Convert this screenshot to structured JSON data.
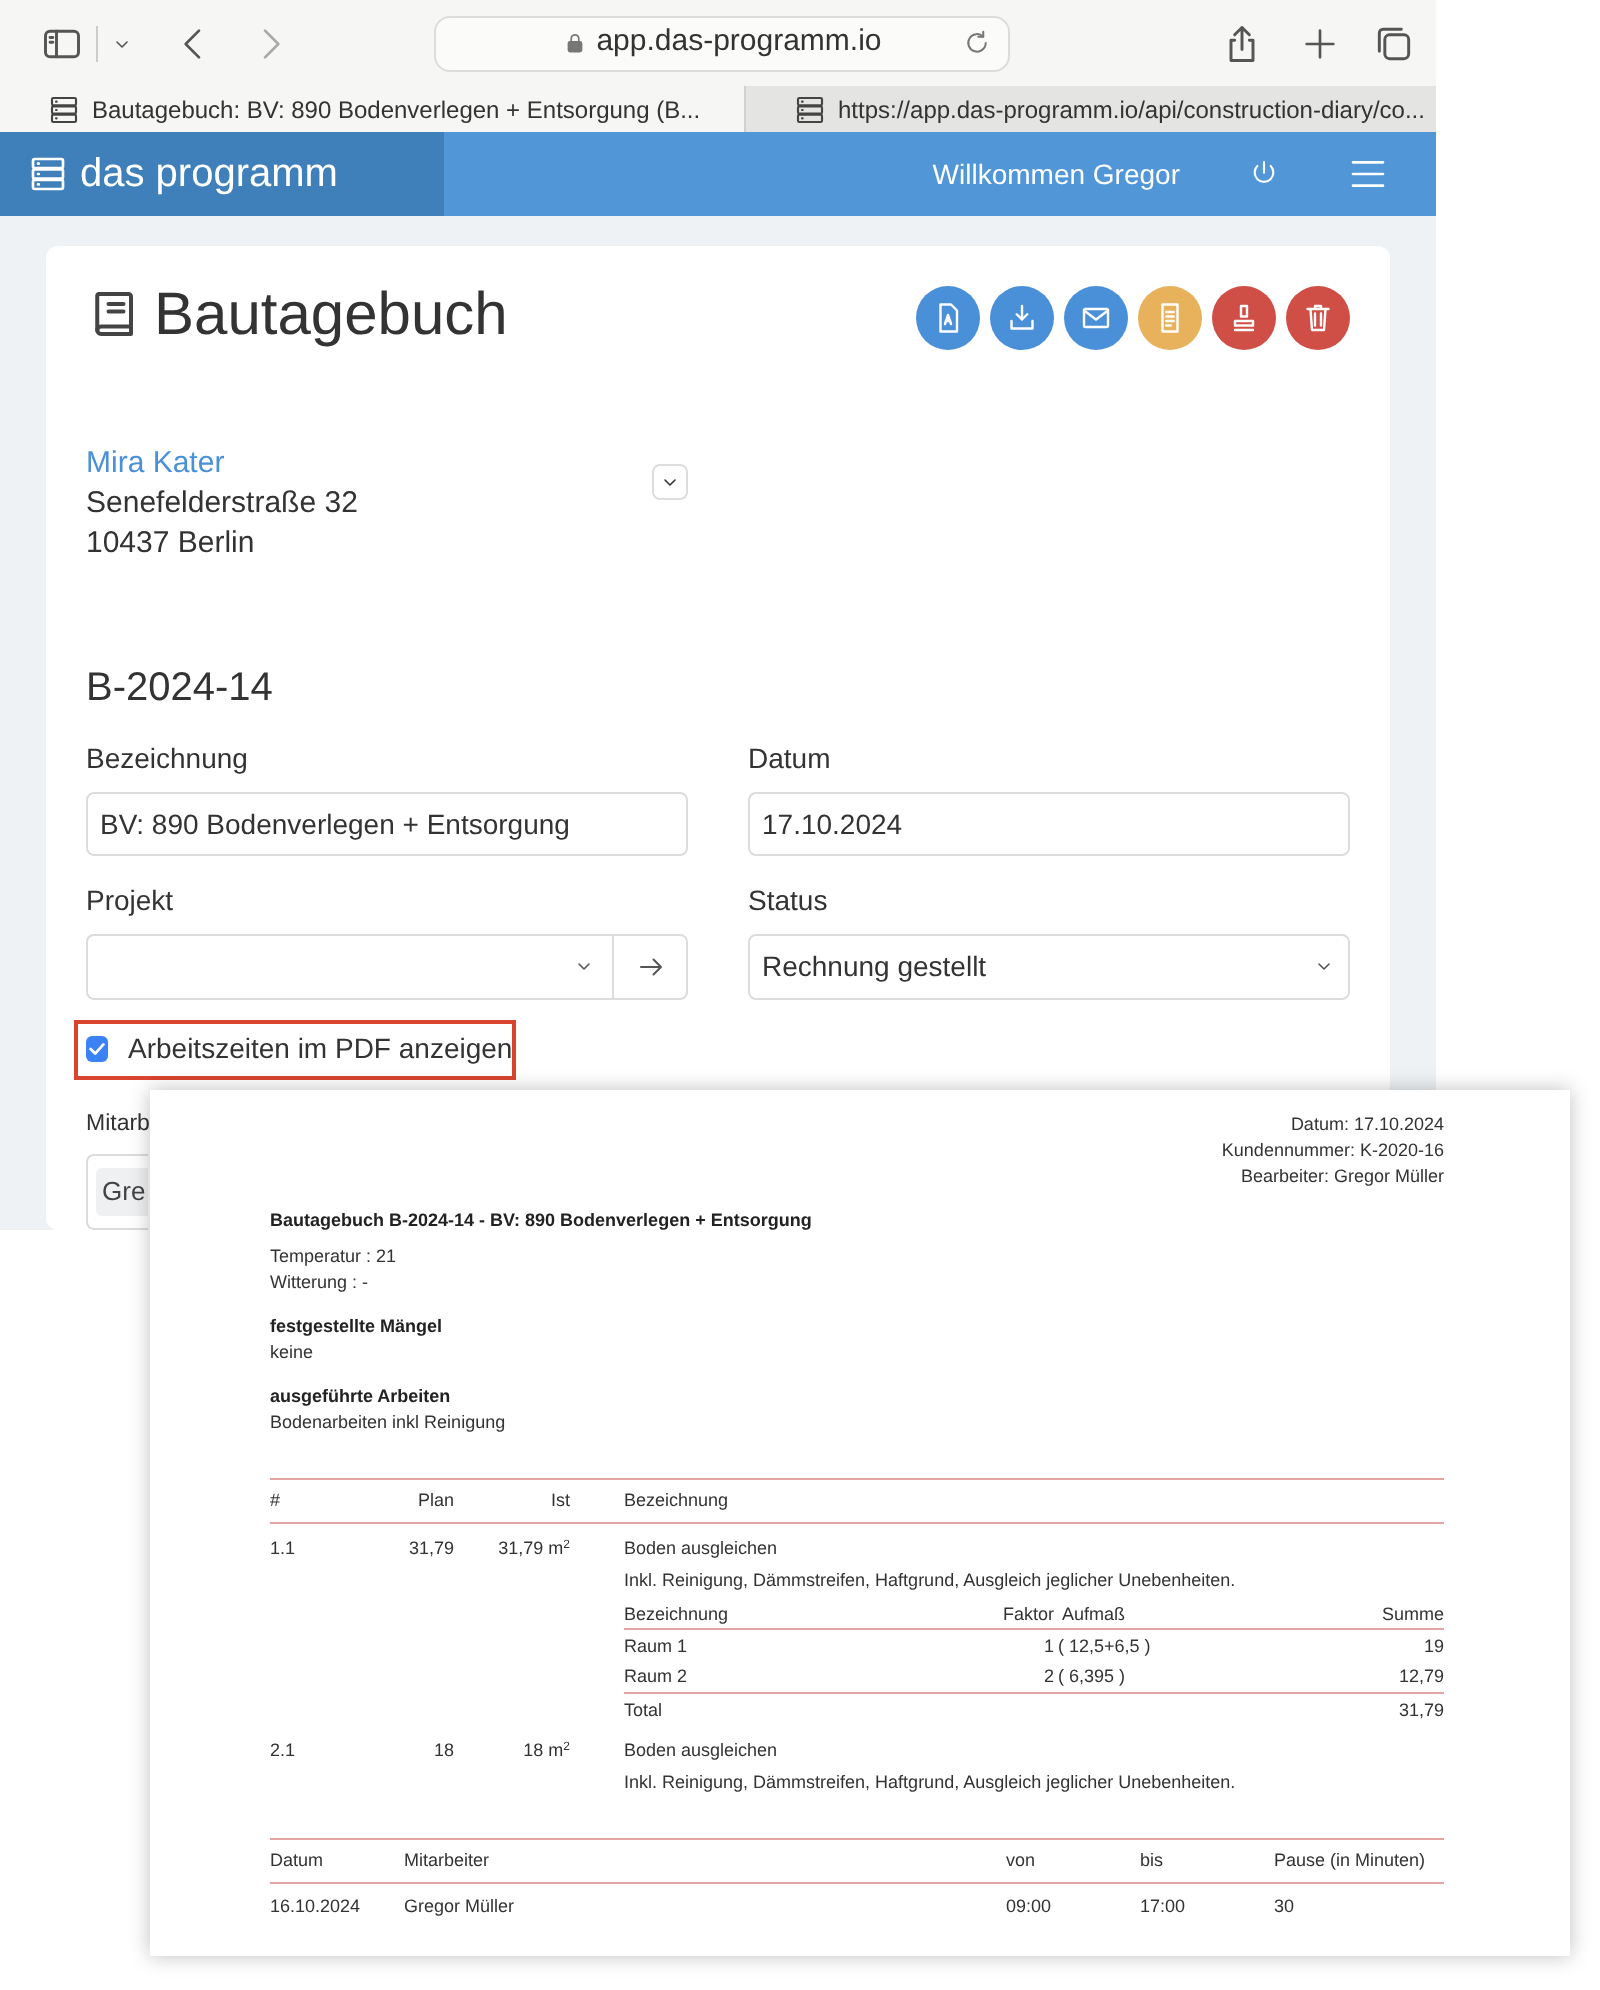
{
  "browser": {
    "address": "app.das-programm.io",
    "tabs": [
      {
        "title": "Bautagebuch: BV: 890 Bodenverlegen + Entsorgung (B...",
        "selected": true
      },
      {
        "title": "https://app.das-programm.io/api/construction-diary/co...",
        "selected": false
      }
    ]
  },
  "header": {
    "brand": "das programm",
    "welcome": "Willkommen Gregor"
  },
  "card": {
    "title": "Bautagebuch",
    "actions": [
      {
        "kind": "pdf",
        "color": "#4a90d9"
      },
      {
        "kind": "download",
        "color": "#4a90d9"
      },
      {
        "kind": "mail",
        "color": "#4a90d9"
      },
      {
        "kind": "document",
        "color": "#e8b25c"
      },
      {
        "kind": "stamp",
        "color": "#cf4e46"
      },
      {
        "kind": "trash",
        "color": "#cf4e46"
      }
    ],
    "customer": {
      "name": "Mira Kater",
      "street": "Senefelderstraße 32",
      "city": "10437 Berlin"
    },
    "number": "B-2024-14",
    "fields": [
      {
        "kind": "text",
        "label": "Bezeichnung",
        "value": "BV: 890 Bodenverlegen + Entsorgung"
      },
      {
        "kind": "text",
        "label": "Datum",
        "value": "17.10.2024"
      },
      {
        "kind": "select-link",
        "label": "Projekt"
      },
      {
        "kind": "select",
        "label": "Status",
        "value": "Rechnung gestellt"
      }
    ],
    "show_times": {
      "label": "Arbeitszeiten im PDF anzeigen",
      "checked": true
    },
    "employees": {
      "label": "Mitarb",
      "chip": "Gre"
    }
  },
  "pdf": {
    "meta": [
      "Datum: 17.10.2024",
      "Kundennummer: K-2020-16",
      "Bearbeiter: Gregor Müller"
    ],
    "title": "Bautagebuch B-2024-14 - BV: 890 Bodenverlegen + Entsorgung",
    "weather": [
      "Temperatur : 21",
      "Witterung : -"
    ],
    "sections": [
      {
        "heading": "festgestellte Mängel",
        "text": "keine"
      },
      {
        "heading": "ausgeführte Arbeiten",
        "text": "Bodenarbeiten inkl Reinigung"
      }
    ],
    "positions": {
      "columns": [
        "#",
        "Plan",
        "Ist",
        "Bezeichnung"
      ],
      "rows": [
        {
          "number": "1.1",
          "plan": "31,79",
          "actual": "31,79 m$^{2}$",
          "name": "Boden ausgleichen",
          "description": "Inkl. Reinigung, Dämmstreifen, Haftgrund, Ausgleich jeglicher Unebenheiten.",
          "measurements": {
            "columns": [
              "Bezeichnung",
              "Faktor",
              "Aufmaß",
              "Summe"
            ],
            "rows": [
              [
                "Raum 1",
                "1",
                "( 12,5+6,5 )",
                "19"
              ],
              [
                "Raum 2",
                "2",
                "( 6,395 )",
                "12,79"
              ]
            ],
            "total": [
              "Total",
              "31,79"
            ]
          }
        },
        {
          "number": "2.1",
          "plan": "18",
          "actual": "18 m$^{2}$",
          "name": "Boden ausgleichen",
          "description": "Inkl. Reinigung, Dämmstreifen, Haftgrund, Ausgleich jeglicher Unebenheiten."
        }
      ]
    },
    "times": {
      "columns": [
        "Datum",
        "Mitarbeiter",
        "von",
        "bis",
        "Pause (in Minuten)"
      ],
      "rows": [
        [
          "16.10.2024",
          "Gregor Müller",
          "09:00",
          "17:00",
          "30"
        ]
      ]
    }
  }
}
